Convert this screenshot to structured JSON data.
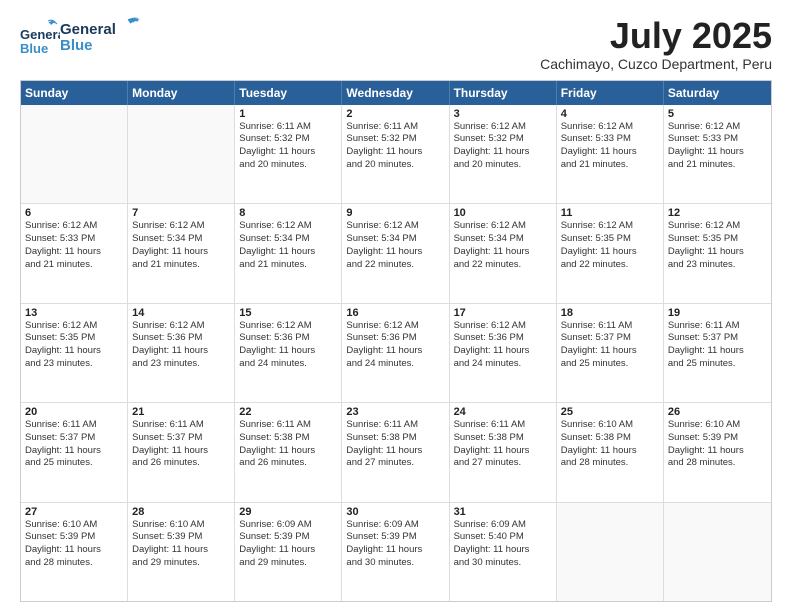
{
  "header": {
    "logo_general": "General",
    "logo_blue": "Blue",
    "month_title": "July 2025",
    "location": "Cachimayo, Cuzco Department, Peru"
  },
  "weekdays": [
    "Sunday",
    "Monday",
    "Tuesday",
    "Wednesday",
    "Thursday",
    "Friday",
    "Saturday"
  ],
  "weeks": [
    [
      {
        "day": "",
        "lines": []
      },
      {
        "day": "",
        "lines": []
      },
      {
        "day": "1",
        "lines": [
          "Sunrise: 6:11 AM",
          "Sunset: 5:32 PM",
          "Daylight: 11 hours",
          "and 20 minutes."
        ]
      },
      {
        "day": "2",
        "lines": [
          "Sunrise: 6:11 AM",
          "Sunset: 5:32 PM",
          "Daylight: 11 hours",
          "and 20 minutes."
        ]
      },
      {
        "day": "3",
        "lines": [
          "Sunrise: 6:12 AM",
          "Sunset: 5:32 PM",
          "Daylight: 11 hours",
          "and 20 minutes."
        ]
      },
      {
        "day": "4",
        "lines": [
          "Sunrise: 6:12 AM",
          "Sunset: 5:33 PM",
          "Daylight: 11 hours",
          "and 21 minutes."
        ]
      },
      {
        "day": "5",
        "lines": [
          "Sunrise: 6:12 AM",
          "Sunset: 5:33 PM",
          "Daylight: 11 hours",
          "and 21 minutes."
        ]
      }
    ],
    [
      {
        "day": "6",
        "lines": [
          "Sunrise: 6:12 AM",
          "Sunset: 5:33 PM",
          "Daylight: 11 hours",
          "and 21 minutes."
        ]
      },
      {
        "day": "7",
        "lines": [
          "Sunrise: 6:12 AM",
          "Sunset: 5:34 PM",
          "Daylight: 11 hours",
          "and 21 minutes."
        ]
      },
      {
        "day": "8",
        "lines": [
          "Sunrise: 6:12 AM",
          "Sunset: 5:34 PM",
          "Daylight: 11 hours",
          "and 21 minutes."
        ]
      },
      {
        "day": "9",
        "lines": [
          "Sunrise: 6:12 AM",
          "Sunset: 5:34 PM",
          "Daylight: 11 hours",
          "and 22 minutes."
        ]
      },
      {
        "day": "10",
        "lines": [
          "Sunrise: 6:12 AM",
          "Sunset: 5:34 PM",
          "Daylight: 11 hours",
          "and 22 minutes."
        ]
      },
      {
        "day": "11",
        "lines": [
          "Sunrise: 6:12 AM",
          "Sunset: 5:35 PM",
          "Daylight: 11 hours",
          "and 22 minutes."
        ]
      },
      {
        "day": "12",
        "lines": [
          "Sunrise: 6:12 AM",
          "Sunset: 5:35 PM",
          "Daylight: 11 hours",
          "and 23 minutes."
        ]
      }
    ],
    [
      {
        "day": "13",
        "lines": [
          "Sunrise: 6:12 AM",
          "Sunset: 5:35 PM",
          "Daylight: 11 hours",
          "and 23 minutes."
        ]
      },
      {
        "day": "14",
        "lines": [
          "Sunrise: 6:12 AM",
          "Sunset: 5:36 PM",
          "Daylight: 11 hours",
          "and 23 minutes."
        ]
      },
      {
        "day": "15",
        "lines": [
          "Sunrise: 6:12 AM",
          "Sunset: 5:36 PM",
          "Daylight: 11 hours",
          "and 24 minutes."
        ]
      },
      {
        "day": "16",
        "lines": [
          "Sunrise: 6:12 AM",
          "Sunset: 5:36 PM",
          "Daylight: 11 hours",
          "and 24 minutes."
        ]
      },
      {
        "day": "17",
        "lines": [
          "Sunrise: 6:12 AM",
          "Sunset: 5:36 PM",
          "Daylight: 11 hours",
          "and 24 minutes."
        ]
      },
      {
        "day": "18",
        "lines": [
          "Sunrise: 6:11 AM",
          "Sunset: 5:37 PM",
          "Daylight: 11 hours",
          "and 25 minutes."
        ]
      },
      {
        "day": "19",
        "lines": [
          "Sunrise: 6:11 AM",
          "Sunset: 5:37 PM",
          "Daylight: 11 hours",
          "and 25 minutes."
        ]
      }
    ],
    [
      {
        "day": "20",
        "lines": [
          "Sunrise: 6:11 AM",
          "Sunset: 5:37 PM",
          "Daylight: 11 hours",
          "and 25 minutes."
        ]
      },
      {
        "day": "21",
        "lines": [
          "Sunrise: 6:11 AM",
          "Sunset: 5:37 PM",
          "Daylight: 11 hours",
          "and 26 minutes."
        ]
      },
      {
        "day": "22",
        "lines": [
          "Sunrise: 6:11 AM",
          "Sunset: 5:38 PM",
          "Daylight: 11 hours",
          "and 26 minutes."
        ]
      },
      {
        "day": "23",
        "lines": [
          "Sunrise: 6:11 AM",
          "Sunset: 5:38 PM",
          "Daylight: 11 hours",
          "and 27 minutes."
        ]
      },
      {
        "day": "24",
        "lines": [
          "Sunrise: 6:11 AM",
          "Sunset: 5:38 PM",
          "Daylight: 11 hours",
          "and 27 minutes."
        ]
      },
      {
        "day": "25",
        "lines": [
          "Sunrise: 6:10 AM",
          "Sunset: 5:38 PM",
          "Daylight: 11 hours",
          "and 28 minutes."
        ]
      },
      {
        "day": "26",
        "lines": [
          "Sunrise: 6:10 AM",
          "Sunset: 5:39 PM",
          "Daylight: 11 hours",
          "and 28 minutes."
        ]
      }
    ],
    [
      {
        "day": "27",
        "lines": [
          "Sunrise: 6:10 AM",
          "Sunset: 5:39 PM",
          "Daylight: 11 hours",
          "and 28 minutes."
        ]
      },
      {
        "day": "28",
        "lines": [
          "Sunrise: 6:10 AM",
          "Sunset: 5:39 PM",
          "Daylight: 11 hours",
          "and 29 minutes."
        ]
      },
      {
        "day": "29",
        "lines": [
          "Sunrise: 6:09 AM",
          "Sunset: 5:39 PM",
          "Daylight: 11 hours",
          "and 29 minutes."
        ]
      },
      {
        "day": "30",
        "lines": [
          "Sunrise: 6:09 AM",
          "Sunset: 5:39 PM",
          "Daylight: 11 hours",
          "and 30 minutes."
        ]
      },
      {
        "day": "31",
        "lines": [
          "Sunrise: 6:09 AM",
          "Sunset: 5:40 PM",
          "Daylight: 11 hours",
          "and 30 minutes."
        ]
      },
      {
        "day": "",
        "lines": []
      },
      {
        "day": "",
        "lines": []
      }
    ]
  ]
}
